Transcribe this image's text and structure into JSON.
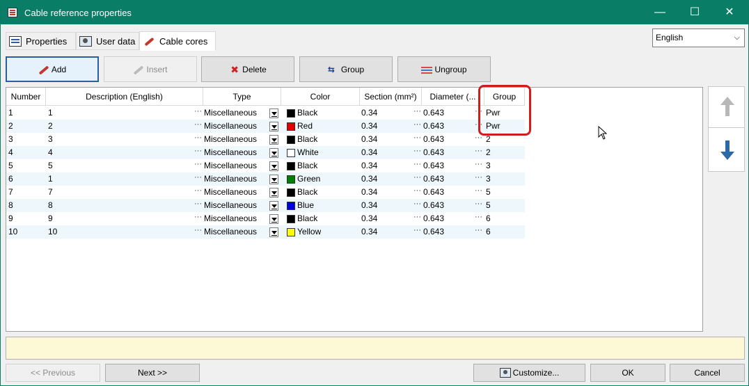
{
  "window": {
    "title": "Cable reference properties",
    "controls": {
      "minimize": "—",
      "maximize": "☐",
      "close": "✕"
    }
  },
  "tabs": [
    {
      "label": "Properties",
      "icon": "properties-icon",
      "active": false
    },
    {
      "label": "User data",
      "icon": "user-data-icon",
      "active": false
    },
    {
      "label": "Cable cores",
      "icon": "cable-icon",
      "active": true
    }
  ],
  "language": {
    "selected": "English",
    "arrow": "⌵"
  },
  "toolbar": {
    "add": "Add",
    "insert": "Insert",
    "delete": "Delete",
    "group": "Group",
    "ungroup": "Ungroup",
    "delete_glyph": "✖",
    "group_glyph": "⇆"
  },
  "table": {
    "headers": [
      "Number",
      "Description (English)",
      "Type",
      "Color",
      "Section (mm²)",
      "Diameter (...",
      "Group"
    ],
    "ellipsis": "···",
    "rows": [
      {
        "number": "1",
        "description": "1",
        "type": "Miscellaneous",
        "color": "Black",
        "swatch": "#000000",
        "section": "0.34",
        "diameter": "0.643",
        "group": "Pwr"
      },
      {
        "number": "2",
        "description": "2",
        "type": "Miscellaneous",
        "color": "Red",
        "swatch": "#e00000",
        "section": "0.34",
        "diameter": "0.643",
        "group": "Pwr"
      },
      {
        "number": "3",
        "description": "3",
        "type": "Miscellaneous",
        "color": "Black",
        "swatch": "#000000",
        "section": "0.34",
        "diameter": "0.643",
        "group": "2"
      },
      {
        "number": "4",
        "description": "4",
        "type": "Miscellaneous",
        "color": "White",
        "swatch": "#ffffff",
        "section": "0.34",
        "diameter": "0.643",
        "group": "2"
      },
      {
        "number": "5",
        "description": "5",
        "type": "Miscellaneous",
        "color": "Black",
        "swatch": "#000000",
        "section": "0.34",
        "diameter": "0.643",
        "group": "3"
      },
      {
        "number": "6",
        "description": "1",
        "type": "Miscellaneous",
        "color": "Green",
        "swatch": "#008000",
        "section": "0.34",
        "diameter": "0.643",
        "group": "3"
      },
      {
        "number": "7",
        "description": "7",
        "type": "Miscellaneous",
        "color": "Black",
        "swatch": "#000000",
        "section": "0.34",
        "diameter": "0.643",
        "group": "5"
      },
      {
        "number": "8",
        "description": "8",
        "type": "Miscellaneous",
        "color": "Blue",
        "swatch": "#0000e0",
        "section": "0.34",
        "diameter": "0.643",
        "group": "5"
      },
      {
        "number": "9",
        "description": "9",
        "type": "Miscellaneous",
        "color": "Black",
        "swatch": "#000000",
        "section": "0.34",
        "diameter": "0.643",
        "group": "6"
      },
      {
        "number": "10",
        "description": "10",
        "type": "Miscellaneous",
        "color": "Yellow",
        "swatch": "#ffff00",
        "section": "0.34",
        "diameter": "0.643",
        "group": "6"
      }
    ]
  },
  "side": {
    "up_icon": "arrow-up-icon",
    "down_icon": "arrow-down-icon"
  },
  "footer": {
    "previous": "<< Previous",
    "next": "Next >>",
    "customize": "Customize...",
    "ok": "OK",
    "cancel": "Cancel"
  },
  "colors": {
    "titlebar": "#0a7d66",
    "highlight": "#d01c1c",
    "info_bar": "#fdf8d5",
    "alt_row": "#eef7fb"
  }
}
